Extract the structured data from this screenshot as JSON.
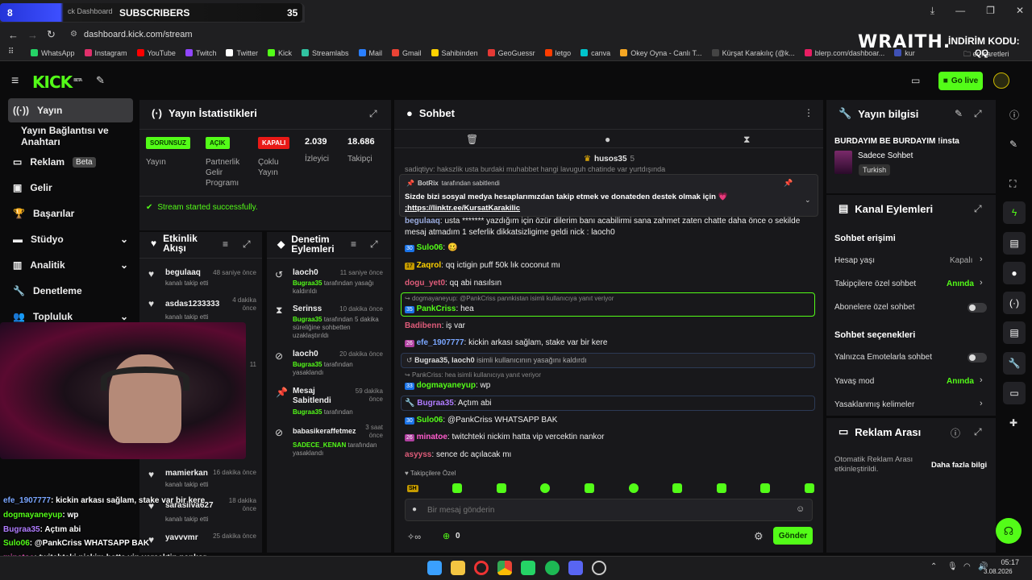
{
  "browser": {
    "tab_title": "ck Dashboard",
    "url": "dashboard.kick.com/stream",
    "sub_count_left": "8",
    "sub_title": "SUBSCRIBERS",
    "sub_count": "35",
    "bookmarks": [
      "WhatsApp",
      "Instagram",
      "YouTube",
      "Twitch",
      "Twitter",
      "Kick",
      "Streamlabs",
      "Mail",
      "Gmail",
      "Sahibinden",
      "GeoGuessr",
      "letgo",
      "canva",
      "Okey Oyna - Canlı T...",
      "Kürşat Karakılıç (@k...",
      "blerp.com/dashboar...",
      "kur"
    ],
    "bookmark_colors": [
      "#25d366",
      "#e1306c",
      "#ff0000",
      "#9146ff",
      "#fff",
      "#53fc18",
      "#31c3a2",
      "#2a7fff",
      "#ea4335",
      "#ffd200",
      "#e53935",
      "#ff3d00",
      "#00c4cc",
      "#f5a623",
      "#444",
      "#e91e63",
      "#3f51b5"
    ],
    "other_bookmarks": "er İşaretleri"
  },
  "overlay": {
    "brand": "WRAITH.",
    "promo": "İNDİRİM KODU:",
    "promo_code": "QQ"
  },
  "header": {
    "logo": "KICK",
    "logo_sup": "BETA",
    "go_live": "Go live"
  },
  "sidebar": {
    "items": [
      {
        "label": "Yayın"
      },
      {
        "label": "Yayın Bağlantısı ve Anahtarı"
      },
      {
        "label": "Reklam",
        "badge": "Beta"
      },
      {
        "label": "Gelir"
      },
      {
        "label": "Başarılar"
      },
      {
        "label": "Stüdyo"
      },
      {
        "label": "Analitik"
      },
      {
        "label": "Denetleme"
      },
      {
        "label": "Topluluk"
      }
    ]
  },
  "stats": {
    "title": "Yayın İstatistikleri",
    "cells": [
      {
        "badge": "SORUNSUZ",
        "label": "Yayın",
        "color": "#53fc18"
      },
      {
        "badge": "AÇIK",
        "label": "Partnerlik Gelir Programı",
        "color": "#53fc18"
      },
      {
        "badge": "KAPALI",
        "label": "Çoklu Yayın",
        "color": "#e91916"
      },
      {
        "value": "2.039",
        "label": "İzleyici"
      },
      {
        "value": "18.686",
        "label": "Takipçi"
      }
    ],
    "success": "Stream started successfully."
  },
  "activity": {
    "title": "Etkinlik Akışı",
    "items": [
      {
        "user": "begulaaq",
        "sub": "kanalı takip etti",
        "time": "48 saniye önce"
      },
      {
        "user": "asdas1233333",
        "sub": "kanalı takip etti",
        "time": "4 dakika önce"
      },
      {
        "time": "11"
      },
      {
        "user": "mamierkan",
        "sub": "kanalı takip etti",
        "time": "16 dakika önce"
      },
      {
        "user": "sarasilva627",
        "sub": "kanalı takip etti",
        "time": "18 dakika önce"
      },
      {
        "user": "yavvvmr",
        "sub": "",
        "time": "25 dakika önce"
      }
    ]
  },
  "moderation": {
    "title": "Denetim Eylemleri",
    "items": [
      {
        "user": "laoch0",
        "sub_user": "Bugraa35",
        "sub": "tarafından yasağı kaldırıldı",
        "time": "11 saniye önce"
      },
      {
        "user": "Serinss",
        "sub_user": "Bugraa35",
        "sub": "tarafından 5 dakika süreliğine sohbetten uzaklaştırıldı",
        "time": "10 dakika önce"
      },
      {
        "user": "laoch0",
        "sub_user": "Bugraa35",
        "sub": "tarafından yasaklandı",
        "time": "20 dakika önce"
      },
      {
        "user": "Mesaj Sabitlendi",
        "sub_user": "Bugraa35",
        "sub": "tarafından",
        "time": "59 dakika önce"
      },
      {
        "user": "babasikeraffetmez",
        "sub_user": "SADECE_KENAN",
        "sub": "tarafından yasaklandı",
        "time": "3 saat önce"
      }
    ]
  },
  "chat": {
    "title": "Sohbet",
    "top_user": "husos35",
    "top_count": "5",
    "pinned": {
      "by": "BotRix",
      "by_suffix": "tarafından sabitlendi",
      "text": "Sizde bizi sosyal medya hesaplarımızdan takip etmek ve donateden destek olmak için 💗",
      "link": ";https://linktr.ee/KursatKarakilic"
    },
    "partial_top": "sadiqtiyv: hakszlik usta burdaki muhabbet hangi lavuguh chatinde var yurtdışında",
    "messages": [
      {
        "user": "begulaaq",
        "color": "#9ad",
        "text": "usta ******* yazdığım için özür dilerim banı acabilirmi sana zahmet zaten chatte daha önce o sekilde mesaj atmadım 1 seferlik dikkatsizligime geldi nick : laoch0"
      },
      {
        "user": "Sulo06",
        "color": "#53fc18",
        "text": "🥴"
      },
      {
        "user": "Zaqrol",
        "color": "#ffd200",
        "text": "qq ictigin puff 50k lık coconut mı"
      },
      {
        "user": "dogu_yet0",
        "color": "#e05c7a",
        "text": "qq abi nasılsın"
      },
      {
        "reply": "dogmayaneyup: @PankCriss pannkistan isimli kullanıcıya yanıt veriyor",
        "user": "PankCriss",
        "color": "#53fc18",
        "text": "hea"
      },
      {
        "user": "Badibenn",
        "color": "#e05c7a",
        "text": "iş var"
      },
      {
        "user": "efe_1907777",
        "color": "#7aa6ff",
        "text": "kickin arkası sağlam, stake var bir kere"
      },
      {
        "system": "Bugraa35, laoch0",
        "system_text": "isimli kullanıcının yasağını kaldırdı"
      },
      {
        "reply": "PankCriss: hea isimli kullanıcıya yanıt veriyor",
        "user": "dogmayaneyup",
        "color": "#53fc18",
        "text": "wp"
      },
      {
        "user": "Bugraa35",
        "color": "#b07cff",
        "text": "Açtım abi"
      },
      {
        "user": "Sulo06",
        "color": "#53fc18",
        "text": "@PankCriss WHATSAPP BAK"
      },
      {
        "user": "minatoe",
        "color": "#ff5ccd",
        "text": "twitchteki nickim hatta vip vercektin nankor"
      },
      {
        "user": "asyyss",
        "color": "#e05c7a",
        "text": "sence dc açılacak mı"
      }
    ],
    "followers_only": "Takipçilere Özel",
    "emote_label": "SH",
    "input_placeholder": "Bir mesaj gönderin",
    "points": "0",
    "send": "Gönder"
  },
  "stream_info": {
    "title": "Yayın bilgisi",
    "stream_title": "BURDAYIM BE BURDAYIM !insta",
    "category": "Sadece Sohbet",
    "language": "Turkish"
  },
  "channel_actions": {
    "title": "Kanal Eylemleri",
    "access_title": "Sohbet erişimi",
    "rows": [
      {
        "label": "Hesap yaşı",
        "value": "Kapalı"
      },
      {
        "label": "Takipçilere özel sohbet",
        "value": "Anında"
      },
      {
        "label": "Abonelere özel sohbet",
        "toggle": true
      }
    ],
    "options_title": "Sohbet seçenekleri",
    "options": [
      {
        "label": "Yalnızca Emotelarla sohbet",
        "toggle": true
      },
      {
        "label": "Yavaş mod",
        "value": "Anında"
      },
      {
        "label": "Yasaklanmış kelimeler"
      }
    ]
  },
  "ad_break": {
    "title": "Reklam Arası",
    "text": "Otomatik Reklam Arası etkinleştirildi.",
    "link": "Daha fazla bilgi"
  },
  "overlay_chat": [
    {
      "user": "efe_1907777",
      "color": "#7aa6ff",
      "text": "kickin arkası sağlam, stake var bir kere"
    },
    {
      "user": "dogmayaneyup",
      "color": "#53fc18",
      "text": "wp"
    },
    {
      "user": "Bugraa35",
      "color": "#b07cff",
      "text": "Açtım abi"
    },
    {
      "user": "Sulo06",
      "color": "#53fc18",
      "text": "@PankCriss WHATSAPP BAK"
    },
    {
      "user": "minatoe",
      "color": "#ff5ccd",
      "text": "twitchteki nickim hatta vip vercektin nankor"
    }
  ],
  "taskbar": {
    "time": "05:17",
    "date": "3.08.2026"
  }
}
